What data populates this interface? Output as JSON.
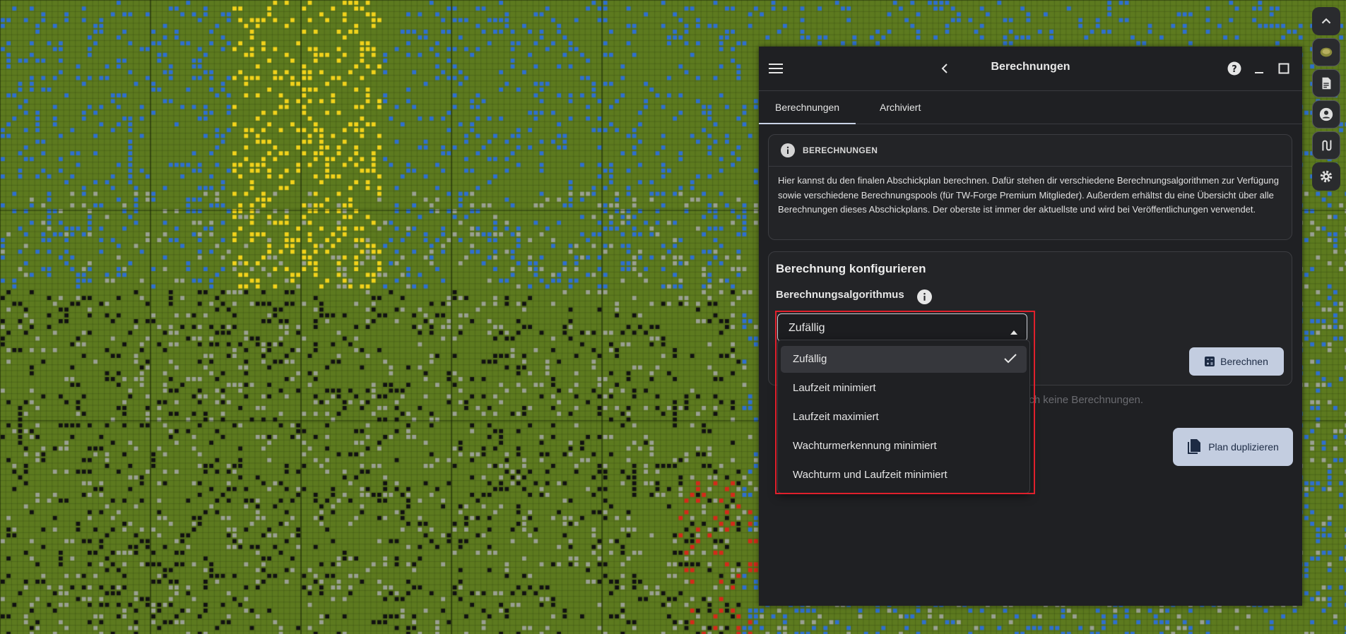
{
  "panel": {
    "title": "Berechnungen"
  },
  "tabs": [
    {
      "label": "Berechnungen",
      "active": true
    },
    {
      "label": "Archiviert",
      "active": false
    }
  ],
  "info": {
    "heading": "BERECHNUNGEN",
    "text": "Hier kannst du den finalen Abschickplan berechnen. Dafür stehen dir verschiedene Berechnungsalgorithmen zur Verfügung sowie verschiedene Berechnungspools (für TW-Forge Premium Mitglieder). Außerdem erhältst du eine Übersicht über alle Berechnungen dieses Abschickplans. Der oberste ist immer der aktuellste und wird bei Veröffentlichungen verwendet."
  },
  "config": {
    "title": "Berechnung konfigurieren",
    "algorithm_label": "Berechnungsalgorithmus",
    "selected": "Zufällig",
    "options": [
      "Zufällig",
      "Laufzeit minimiert",
      "Laufzeit maximiert",
      "Wachturmerkennung minimiert",
      "Wachturm und Laufzeit minimiert"
    ],
    "calculate_label": "Berechnen"
  },
  "empty_text": "Für diesen Plan gibt es noch keine Berechnungen.",
  "duplicate_label": "Plan duplizieren",
  "colors": {
    "map_green": "#5d7a1f",
    "panel_bg": "#1f2023",
    "button_bg": "#c3cde0",
    "highlight": "#e0202c"
  },
  "toolbar_icons": [
    "chevron-up-icon",
    "world-icon",
    "document-icon",
    "account-icon",
    "route-icon",
    "settings-icon"
  ]
}
